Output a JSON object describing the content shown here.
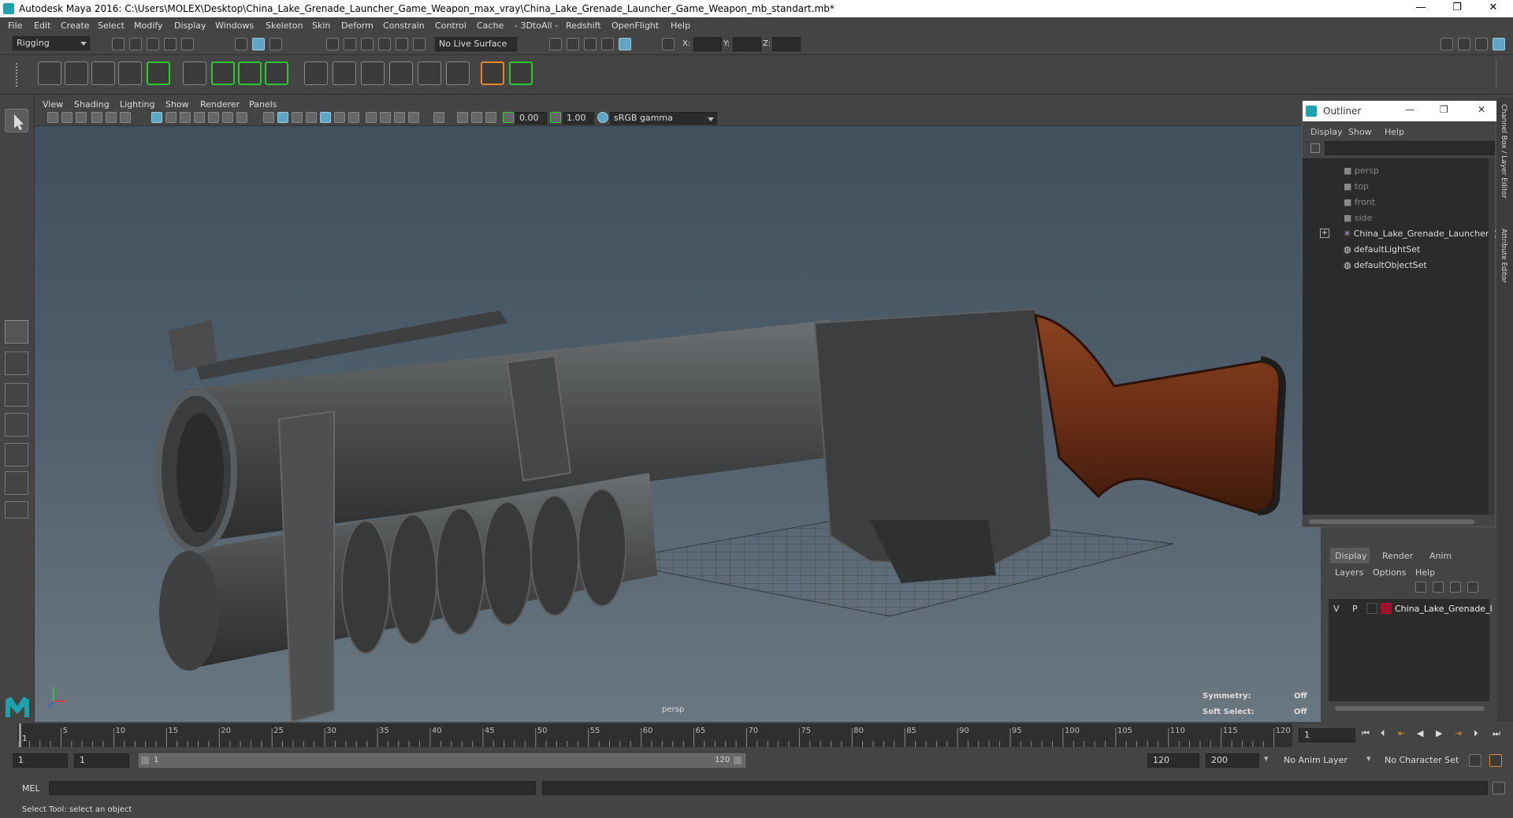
{
  "window": {
    "title": "Autodesk Maya 2016: C:\\Users\\MOLEX\\Desktop\\China_Lake_Grenade_Launcher_Game_Weapon_max_vray\\China_Lake_Grenade_Launcher_Game_Weapon_mb_standart.mb*",
    "minimize": "—",
    "restore": "❐",
    "close": "✕"
  },
  "menubar": [
    "File",
    "Edit",
    "Create",
    "Select",
    "Modify",
    "Display",
    "Windows",
    "Skeleton",
    "Skin",
    "Deform",
    "Constrain",
    "Control",
    "Cache",
    "- 3DtoAll -",
    "Redshift",
    "OpenFlight",
    "Help"
  ],
  "statusbar": {
    "mode": "Rigging",
    "live_surface": "No Live Surface",
    "x_label": "X:",
    "y_label": "Y:",
    "z_label": "Z:"
  },
  "viewport": {
    "menu": [
      "View",
      "Shading",
      "Lighting",
      "Show",
      "Renderer",
      "Panels"
    ],
    "exposure": "0.00",
    "gamma": "1.00",
    "colorspace": "sRGB gamma",
    "camera_label": "persp",
    "symmetry_label": "Symmetry:",
    "symmetry_value": "Off",
    "soft_select_label": "Soft Select:",
    "soft_select_value": "Off"
  },
  "outliner": {
    "title": "Outliner",
    "menu": [
      "Display",
      "Show",
      "Help"
    ],
    "items": [
      "persp",
      "top",
      "front",
      "side",
      "China_Lake_Grenade_Launcher_(",
      "defaultLightSet",
      "defaultObjectSet"
    ]
  },
  "side_tabs": [
    "Channel Box / Layer Editor",
    "Attribute Editor"
  ],
  "layer_editor": {
    "tabs": [
      "Display",
      "Render",
      "Anim"
    ],
    "menu": [
      "Layers",
      "Options",
      "Help"
    ],
    "layer": {
      "v": "V",
      "p": "P",
      "name": "China_Lake_Grenade_l",
      "color": "#a0102a"
    }
  },
  "timeline": {
    "ticks": [
      "5",
      "10",
      "15",
      "20",
      "25",
      "30",
      "35",
      "40",
      "45",
      "50",
      "55",
      "60",
      "65",
      "70",
      "75",
      "80",
      "85",
      "90",
      "95",
      "100",
      "105",
      "110",
      "115",
      "120"
    ],
    "first_tick": "1",
    "current_frame": "1"
  },
  "range": {
    "start": "1",
    "playback_start": "1",
    "slider_start": "1",
    "slider_end": "120",
    "playback_end": "120",
    "end": "200",
    "anim_layer": "No Anim Layer",
    "character_set": "No Character Set"
  },
  "command": {
    "language": "MEL"
  },
  "status": {
    "help_line": "Select Tool: select an object"
  },
  "colors": {
    "accent": "#5ea5c7",
    "shelf_green": "#2fc72f",
    "shelf_orange": "#e08a2a",
    "wood": "#6b2e16",
    "metal": "#4a4c4d"
  }
}
